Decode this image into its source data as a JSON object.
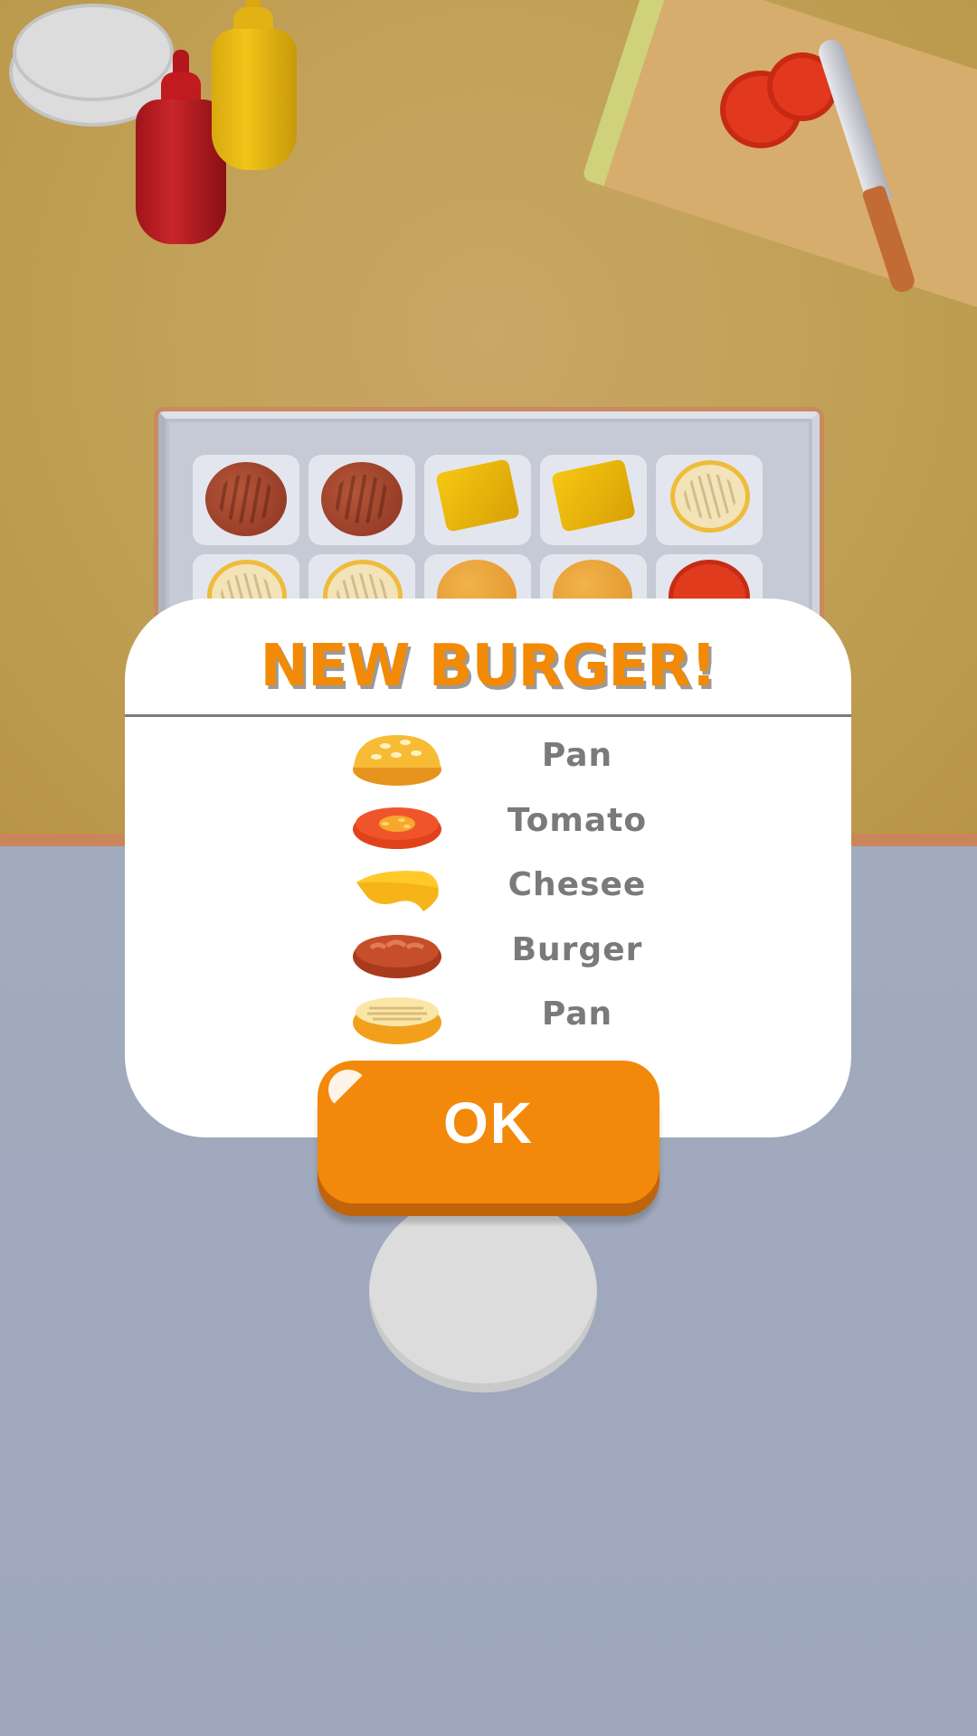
{
  "dialog": {
    "title": "NEW BURGER!",
    "ingredients": [
      {
        "label": "Pan",
        "icon": "bun-top-icon"
      },
      {
        "label": "Tomato",
        "icon": "tomato-slice-icon"
      },
      {
        "label": "Chesee",
        "icon": "cheese-slice-icon"
      },
      {
        "label": "Burger",
        "icon": "patty-icon"
      },
      {
        "label": "Pan",
        "icon": "bun-bottom-icon"
      }
    ],
    "ok_label": "OK"
  },
  "colors": {
    "accent": "#f28a06",
    "label_gray": "#7a7a7a",
    "floor": "#9ea7bc",
    "counter": "#c0a055"
  }
}
